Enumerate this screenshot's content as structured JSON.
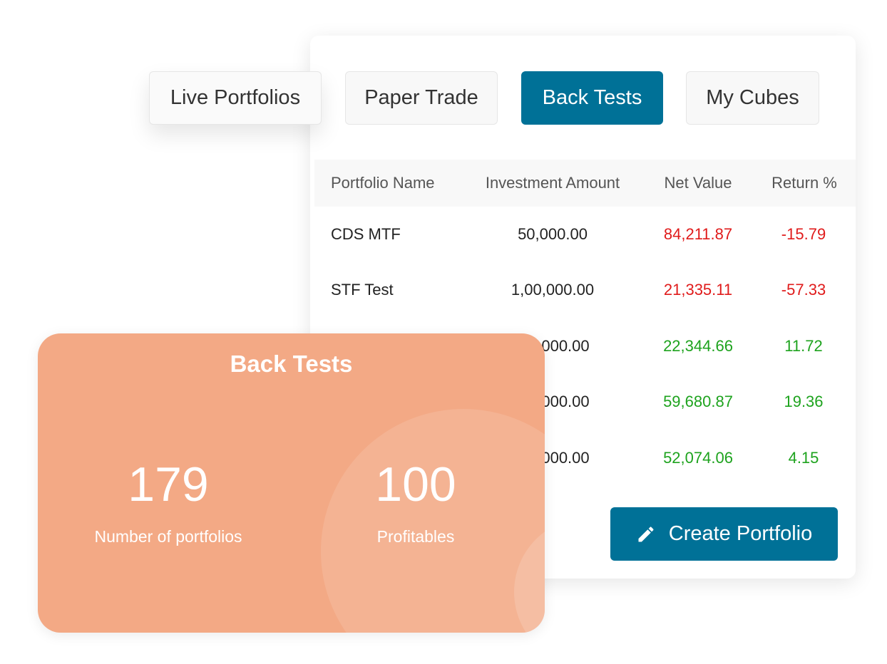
{
  "tabs": {
    "live": "Live Portfolios",
    "paper": "Paper Trade",
    "back": "Back Tests",
    "cubes": "My Cubes",
    "active": "back",
    "active_color": "#007197"
  },
  "table": {
    "headers": {
      "name": "Portfolio Name",
      "investment": "Investment Amount",
      "net": "Net Value",
      "ret": "Return %"
    },
    "rows": [
      {
        "name": "CDS MTF",
        "investment": "50,000.00",
        "net": "84,211.87",
        "ret": "-15.79",
        "status": "negative"
      },
      {
        "name": "STF Test",
        "investment": "1,00,000.00",
        "net": "21,335.11",
        "ret": "-57.33",
        "status": "negative"
      },
      {
        "name": "",
        "investment": "000.00",
        "net": "22,344.66",
        "ret": "11.72",
        "status": "positive"
      },
      {
        "name": "",
        "investment": "000.00",
        "net": "59,680.87",
        "ret": "19.36",
        "status": "positive"
      },
      {
        "name": "",
        "investment": "000.00",
        "net": "52,074.06",
        "ret": "4.15",
        "status": "positive"
      }
    ],
    "negative_color": "#e01b1b",
    "positive_color": "#1ea31e"
  },
  "create_button": {
    "label": "Create Portfolio",
    "icon": "pencil-icon"
  },
  "summary": {
    "title": "Back Tests",
    "portfolios_count": "179",
    "portfolios_label": "Number of portfolios",
    "profitable_count": "100",
    "profitable_label": "Profitables",
    "background_color": "#f3a985"
  }
}
